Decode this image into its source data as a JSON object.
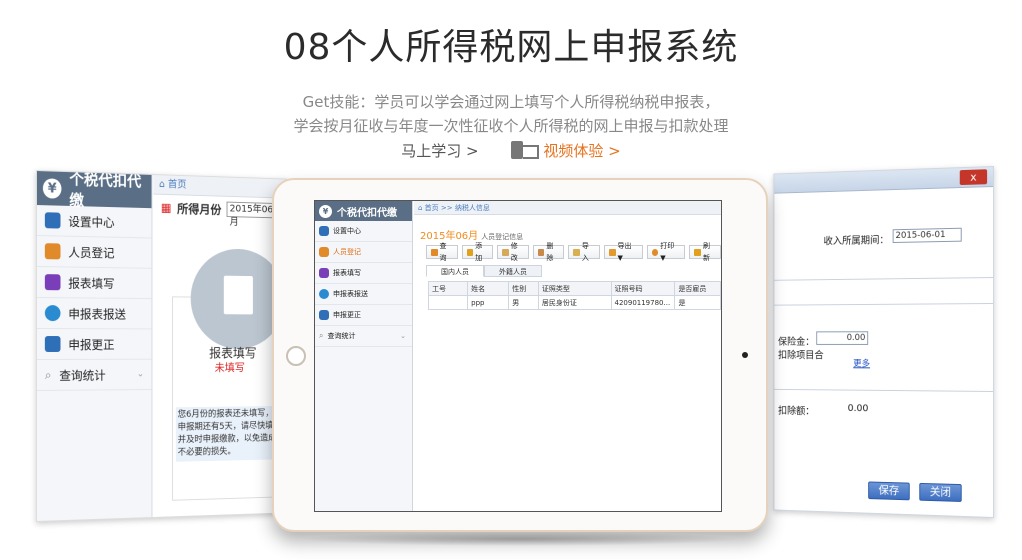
{
  "page": {
    "title": "08个人所得税网上申报系统",
    "subtitle_line1": "Get技能：学员可以学会通过网上填写个人所得税纳税申报表，",
    "subtitle_line2": "学会按月征收与年度一次性征收个人所得税的网上申报与扣款处理",
    "learn_link": "马上学习 >",
    "video_link": "视频体验 >",
    "colors": {
      "accent": "#e8731e",
      "brand": "#5a6f86",
      "link": "#4a7cbf"
    }
  },
  "left_panel": {
    "brand": "个税代扣代缴",
    "brand_icon": "yen-icon",
    "nav": [
      {
        "label": "设置中心",
        "icon": "settings-icon",
        "color": "#2f6fb8"
      },
      {
        "label": "人员登记",
        "icon": "people-icon",
        "color": "#e08a2a"
      },
      {
        "label": "报表填写",
        "icon": "report-icon",
        "color": "#7a3fb8"
      },
      {
        "label": "申报表报送",
        "icon": "send-icon",
        "color": "#2a8bd0"
      },
      {
        "label": "申报更正",
        "icon": "edit-icon",
        "color": "#2f6fb8"
      },
      {
        "label": "查询统计",
        "icon": "search-icon",
        "color": "#888888"
      }
    ],
    "breadcrumb": "首页",
    "month_label": "所得月份",
    "month_value": "2015年06月",
    "card_title": "报表填写",
    "card_status": "未填写",
    "note": "您6月份的报表还未填写，离申报期还有5天，请尽快填写并及时申报缴款，以免造成不必要的损失。"
  },
  "tablet": {
    "brand": "个税代扣代缴",
    "nav": [
      {
        "label": "设置中心",
        "color": "#2f6fb8"
      },
      {
        "label": "人员登记",
        "color": "#e08a2a"
      },
      {
        "label": "报表填写",
        "color": "#7a3fb8"
      },
      {
        "label": "申报表报送",
        "color": "#2a8bd0"
      },
      {
        "label": "申报更正",
        "color": "#2f6fb8"
      },
      {
        "label": "查询统计",
        "color": "#888888"
      }
    ],
    "breadcrumb": "首页 >> 纳税人信息",
    "month": "2015年06月",
    "month_sub": "人员登记信息",
    "toolbar": [
      "查询",
      "添加",
      "修改",
      "删除",
      "导入",
      "导出 ▼",
      "打印 ▼",
      "刷新"
    ],
    "tabs": [
      "国内人员",
      "外籍人员"
    ],
    "columns": [
      "工号",
      "姓名",
      "性别",
      "证照类型",
      "证照号码",
      "是否雇员"
    ],
    "rows": [
      [
        "",
        "ppp",
        "男",
        "居民身份证",
        "42090119780...",
        "是"
      ]
    ]
  },
  "right_panel": {
    "close": "x",
    "label_period": "收入所属期间：",
    "period_value": "2015-06-01",
    "label_insurance": "保险金：",
    "insurance_value": "0.00",
    "label_deduct": "扣除项目合",
    "deduct_link": "更多",
    "label_total": "扣除额：",
    "total_value": "0.00",
    "save_button": "保存",
    "close_button": "关闭"
  }
}
